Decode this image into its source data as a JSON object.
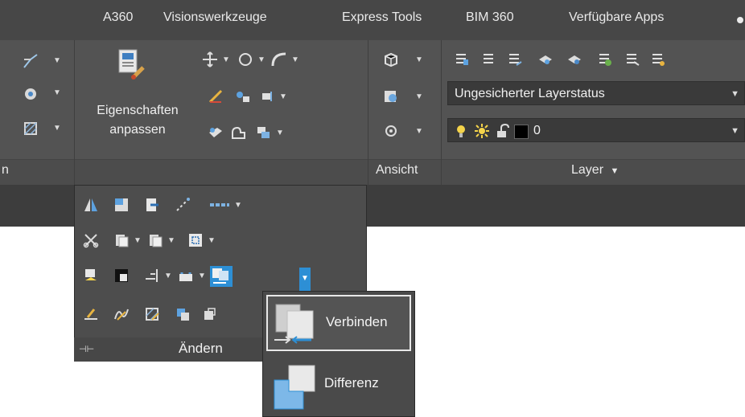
{
  "tabs": [
    {
      "label": "A360"
    },
    {
      "label": "Visionswerkzeuge"
    },
    {
      "label": "Express Tools"
    },
    {
      "label": "BIM 360"
    },
    {
      "label": "Verfügbare Apps"
    }
  ],
  "ribbon": {
    "left_panel_title_fragment": "n",
    "eigenschaften_line1": "Eigenschaften",
    "eigenschaften_line2": "anpassen",
    "ansicht_title": "Ansicht",
    "layer": {
      "title": "Layer",
      "layerstatus_value": "Ungesicherter Layerstatus",
      "current_layer_value": "0",
      "current_layer_color": "#000000"
    }
  },
  "aendern_panel": {
    "title": "Ändern"
  },
  "flyout": {
    "items": [
      {
        "label": "Verbinden",
        "active": true
      },
      {
        "label": "Differenz",
        "active": false
      }
    ]
  },
  "colors": {
    "ribbon_bg": "#535353",
    "accent_blue": "#2d8fd5"
  }
}
